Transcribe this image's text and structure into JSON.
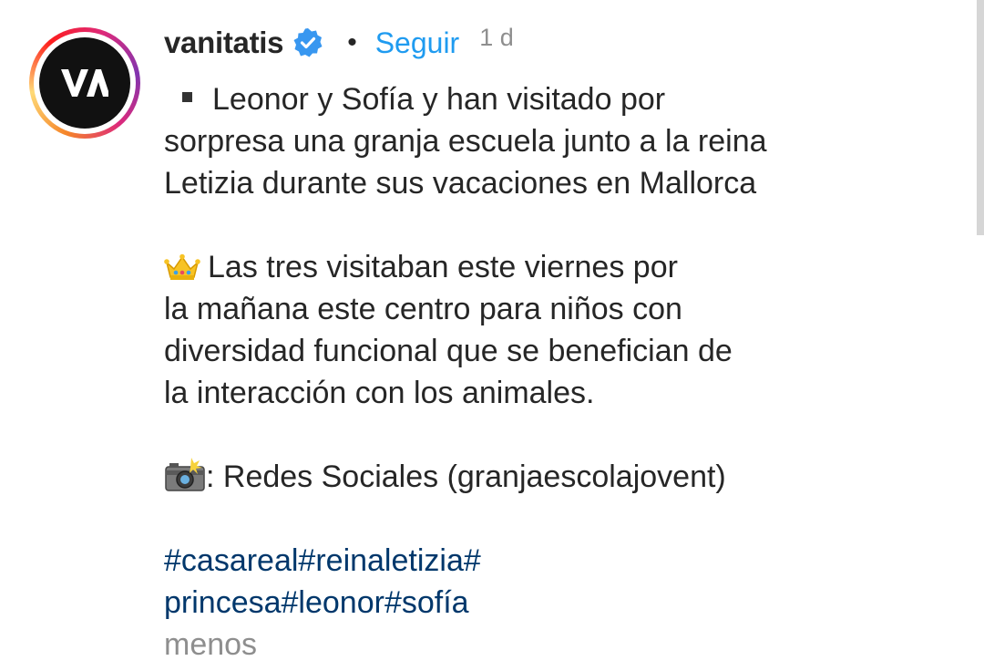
{
  "account": {
    "username": "vanitatis",
    "avatar_text": "VA",
    "verified_icon": "verified-badge-icon",
    "separator": "•",
    "follow_label": "Seguir",
    "time_ago": "1 d"
  },
  "caption": {
    "paragraph1": [
      "Leonor y Sofía y han visitado por",
      "sorpresa una granja escuela junto a la reina",
      "Letizia durante sus vacaciones en Mallorca"
    ],
    "paragraph2": [
      "Las tres visitaban este viernes por",
      "la mañana este centro para niños con",
      "diversidad funcional que se benefician de",
      "la interacción con los animales."
    ],
    "credit": ": Redes Sociales (granjaescolajovent)",
    "hashtag_lines": [
      [
        "#casareal",
        "#reinaletizia",
        "#"
      ],
      [
        "princesa",
        "#leonor",
        "#sofía"
      ]
    ],
    "less_label": "menos"
  },
  "colors": {
    "link_blue": "#1f9bf0",
    "hashtag_blue": "#00376b",
    "muted_gray": "#8e8e8e",
    "text_dark": "#262626"
  },
  "icons": {
    "bullet": "square-bullet-icon",
    "crown": "crown-emoji-icon",
    "camera": "camera-flash-emoji-icon"
  }
}
